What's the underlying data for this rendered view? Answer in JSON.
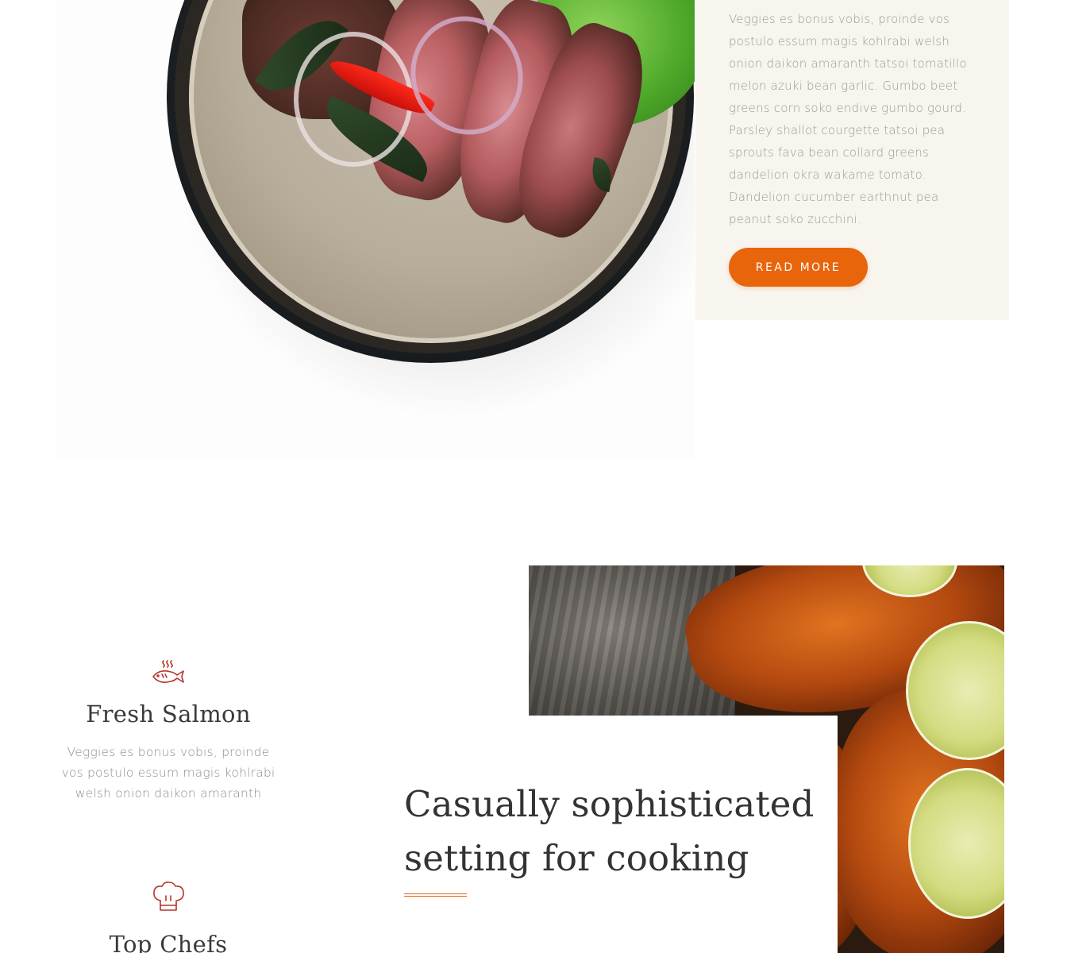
{
  "top": {
    "description": "Veggies es bonus vobis, proinde vos postulo essum magis kohlrabi welsh onion daikon amaranth tatsoi tomatillo melon azuki bean garlic. Gumbo beet greens corn soko endive gumbo gourd. Parsley shallot courgette tatsoi pea sprouts fava bean collard greens dandelion okra wakame tomato. Dandelion cucumber earthnut pea peanut soko zucchini.",
    "button_label": "READ MORE",
    "accent_color": "#e8650c"
  },
  "features": [
    {
      "icon": "fish-icon",
      "title": "Fresh Salmon",
      "description": "Veggies es bonus vobis, proinde vos postulo essum magis kohlrabi welsh onion daikon amaranth"
    },
    {
      "icon": "chef-hat-icon",
      "title": "Top Chefs"
    }
  ],
  "headline": {
    "text": "Casually sophisticated setting for cooking"
  },
  "colors": {
    "icon": "#b5342a",
    "info_box_bg": "#f8f5ef"
  }
}
